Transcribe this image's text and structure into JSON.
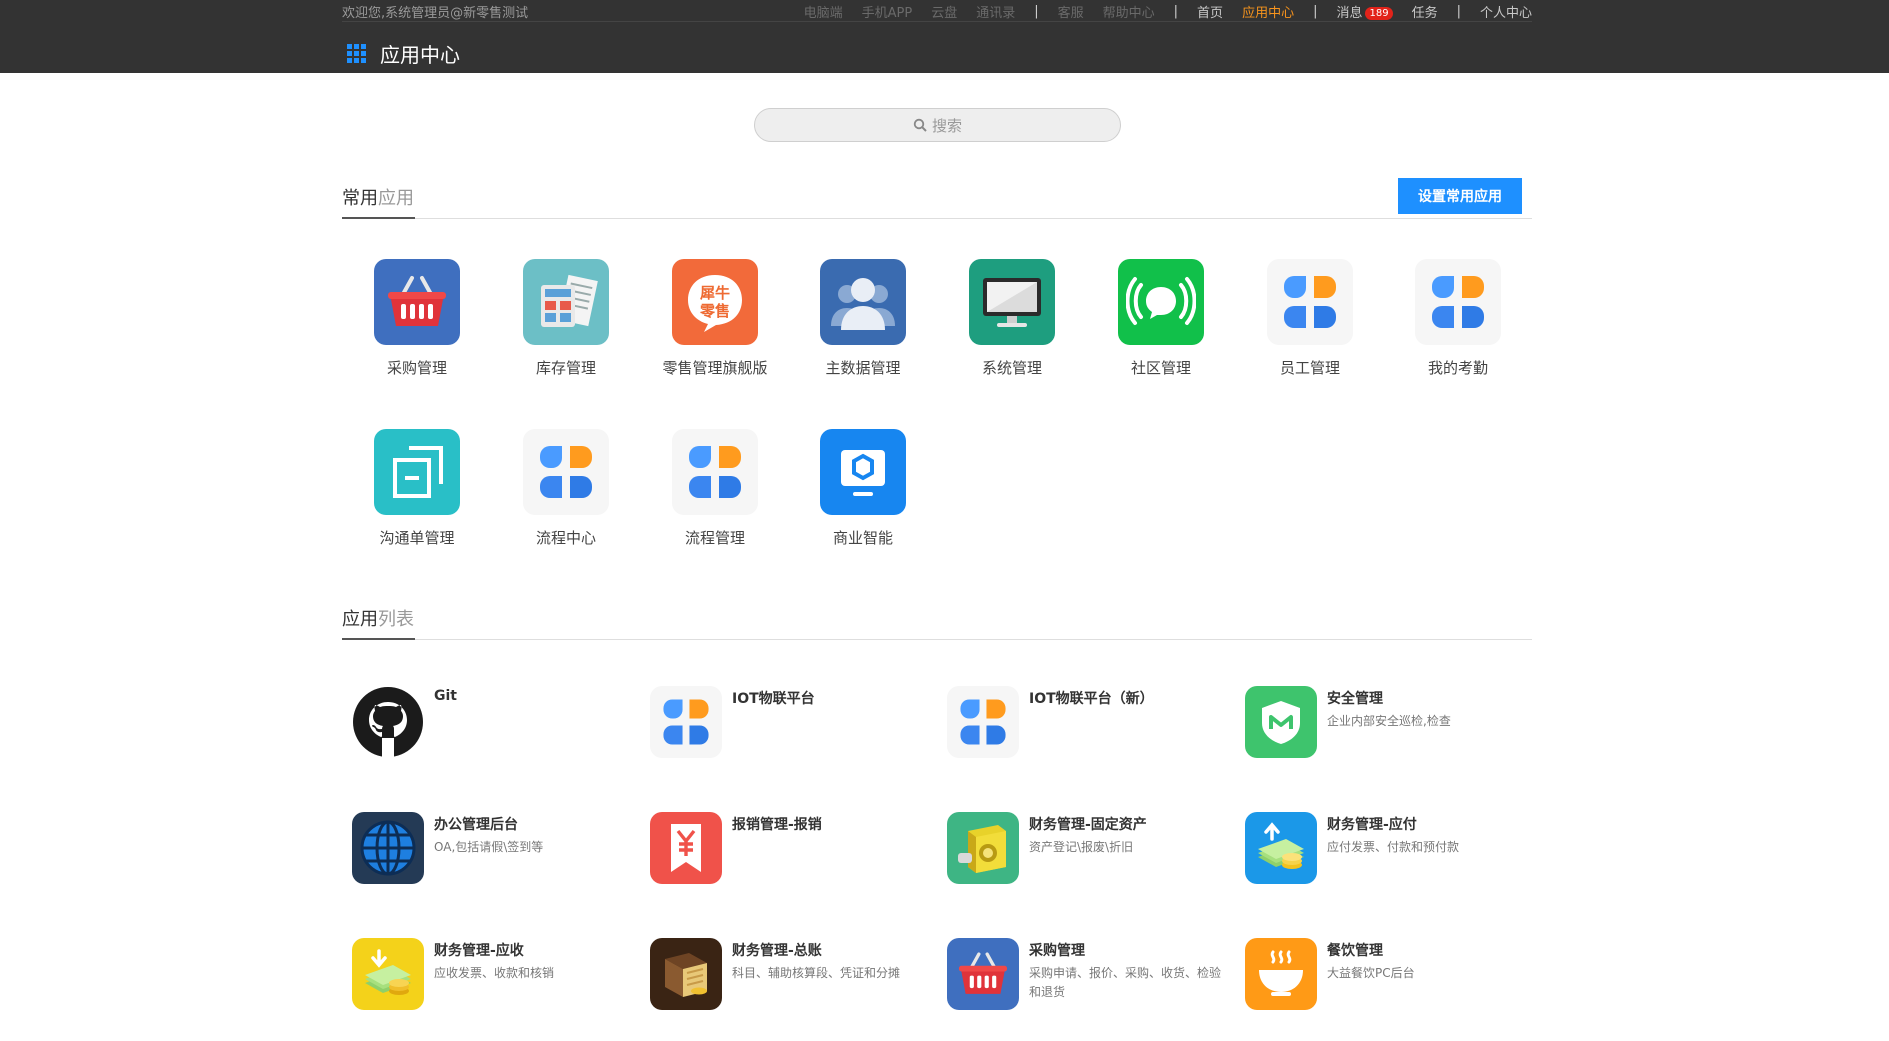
{
  "header": {
    "welcome": "欢迎您,系统管理员@新零售测试",
    "nav_dim": [
      "电脑端",
      "手机APP",
      "云盘",
      "通讯录"
    ],
    "nav_dim2": [
      "客服",
      "帮助中心"
    ],
    "nav_home": "首页",
    "nav_active": "应用中心",
    "nav_messages": "消息",
    "messages_count": "189",
    "nav_tasks": "任务",
    "nav_personal": "个人中心",
    "separator": "|",
    "title": "应用中心"
  },
  "search": {
    "placeholder": "搜索"
  },
  "favorites": {
    "title_dark": "常用",
    "title_light": "应用",
    "set_button": "设置常用应用",
    "items": [
      {
        "label": "采购管理",
        "icon": "shopping-basket-icon"
      },
      {
        "label": "库存管理",
        "icon": "calculator-docs-icon"
      },
      {
        "label": "零售管理旗舰版",
        "icon": "xiniu-retail-logo",
        "logo_text": [
          "犀牛",
          "零售"
        ]
      },
      {
        "label": "主数据管理",
        "icon": "users-group-icon"
      },
      {
        "label": "系统管理",
        "icon": "monitor-icon"
      },
      {
        "label": "社区管理",
        "icon": "broadcast-chat-icon"
      },
      {
        "label": "员工管理",
        "icon": "app-flower-icon"
      },
      {
        "label": "我的考勤",
        "icon": "app-flower-icon"
      },
      {
        "label": "沟通单管理",
        "icon": "copy-document-icon"
      },
      {
        "label": "流程中心",
        "icon": "app-flower-icon"
      },
      {
        "label": "流程管理",
        "icon": "app-flower-icon"
      },
      {
        "label": "商业智能",
        "icon": "bi-monitor-icon"
      }
    ]
  },
  "applist": {
    "title_dark": "应用",
    "title_light": "列表",
    "items": [
      {
        "name": "Git",
        "desc": "",
        "icon": "github-icon"
      },
      {
        "name": "IOT物联平台",
        "desc": "",
        "icon": "app-flower-icon"
      },
      {
        "name": "IOT物联平台（新）",
        "desc": "",
        "icon": "app-flower-icon"
      },
      {
        "name": "安全管理",
        "desc": "企业内部安全巡检,检查",
        "icon": "shield-icon"
      },
      {
        "name": "办公管理后台",
        "desc": "OA,包括请假\\签到等",
        "icon": "globe-icon"
      },
      {
        "name": "报销管理-报销",
        "desc": "",
        "icon": "yuan-bookmark-icon"
      },
      {
        "name": "财务管理-固定资产",
        "desc": "资产登记\\报废\\折旧",
        "icon": "safe-box-icon"
      },
      {
        "name": "财务管理-应付",
        "desc": "应付发票、付款和预付款",
        "icon": "money-out-icon"
      },
      {
        "name": "财务管理-应收",
        "desc": "应收发票、收款和核销",
        "icon": "money-in-icon"
      },
      {
        "name": "财务管理-总账",
        "desc": "科目、辅助核算段、凭证和分摊",
        "icon": "ledger-book-icon"
      },
      {
        "name": "采购管理",
        "desc": "采购申请、报价、采购、收货、检验和退货",
        "icon": "shopping-basket-icon"
      },
      {
        "name": "餐饮管理",
        "desc": "大益餐饮PC后台",
        "icon": "noodle-bowl-icon"
      }
    ]
  },
  "colors": {
    "topbar": "#333333",
    "accent": "#1e90ff",
    "active": "#f7941d",
    "badge": "#e2231a"
  }
}
